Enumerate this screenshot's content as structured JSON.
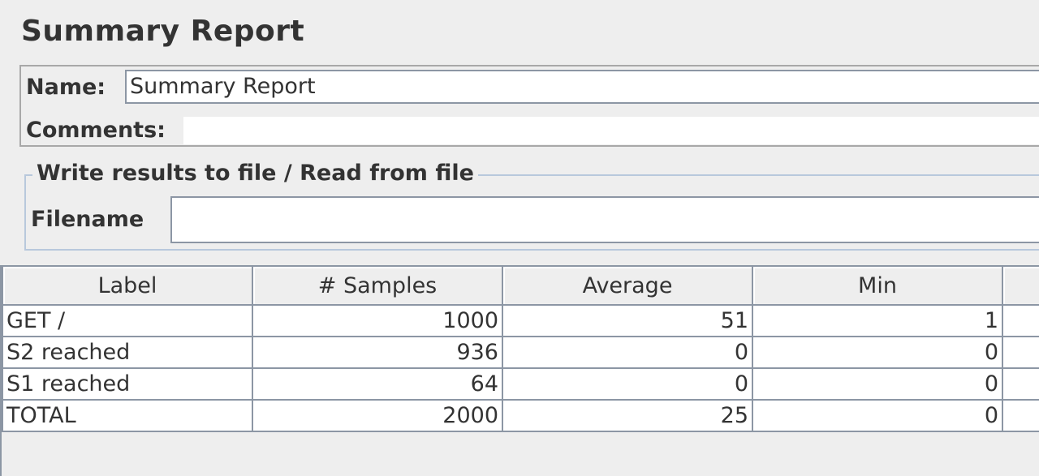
{
  "panel": {
    "title": "Summary Report"
  },
  "name_field": {
    "label": "Name:",
    "value": "Summary Report"
  },
  "comments_field": {
    "label": "Comments:",
    "value": ""
  },
  "file_group": {
    "legend": "Write results to file / Read from file",
    "filename_label": "Filename",
    "filename_value": ""
  },
  "table": {
    "columns": [
      "Label",
      "# Samples",
      "Average",
      "Min",
      ""
    ],
    "rows": [
      [
        "GET /",
        "1000",
        "51",
        "1",
        ""
      ],
      [
        "S2 reached",
        "936",
        "0",
        "0",
        ""
      ],
      [
        "S1 reached",
        "64",
        "0",
        "0",
        ""
      ],
      [
        "TOTAL",
        "2000",
        "25",
        "0",
        ""
      ]
    ]
  },
  "colors": {
    "background": "#eeeeee",
    "border": "#8c96a4",
    "group_border": "#b8c8dc",
    "text": "#333333"
  }
}
